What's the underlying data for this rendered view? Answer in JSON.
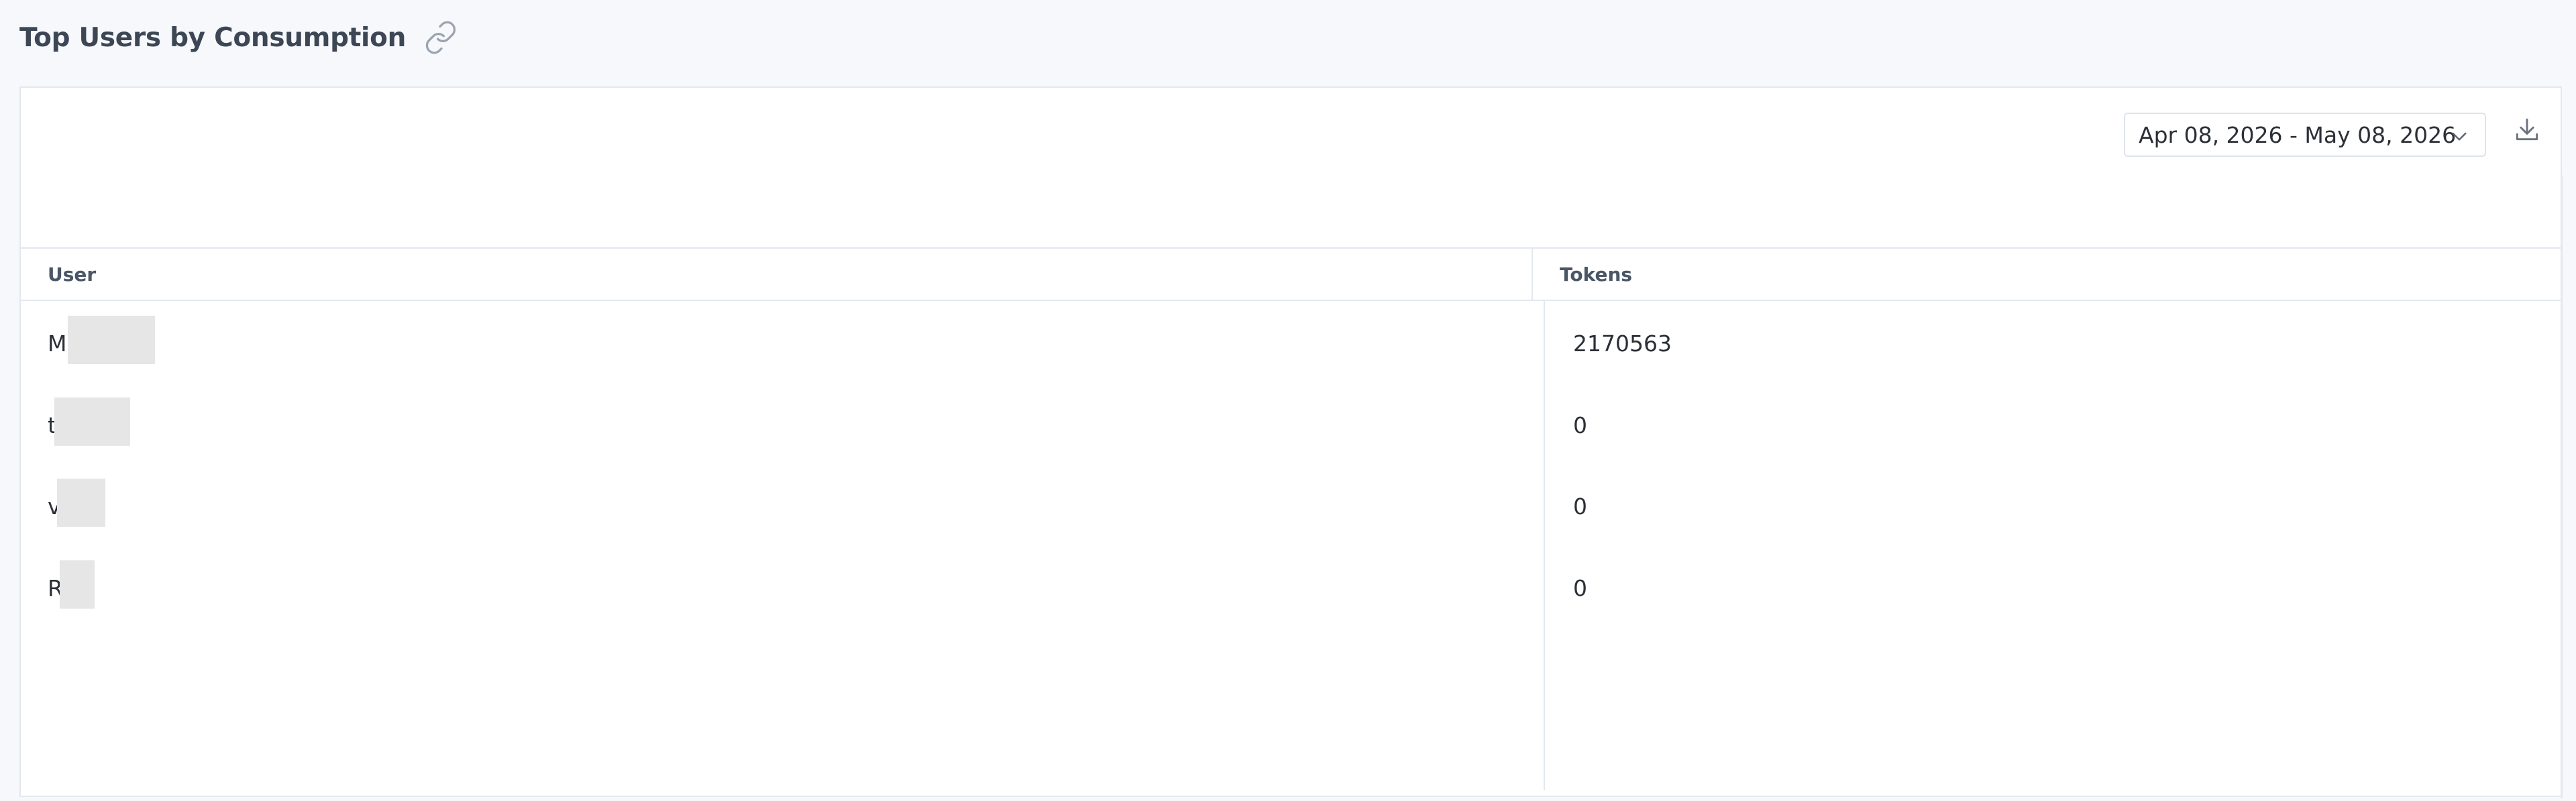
{
  "header": {
    "title": "Top Users by Consumption",
    "link_icon": "link-icon"
  },
  "toolbar": {
    "date_range": "Apr 08, 2026 - May 08, 2026",
    "chevron_icon": "chevron-down-icon",
    "download_icon": "download-icon"
  },
  "table": {
    "columns": [
      "User",
      "Tokens"
    ],
    "rows": [
      {
        "user": "M          d",
        "tokens": "2170563"
      },
      {
        "user": "t        i",
        "tokens": "0"
      },
      {
        "user": "v     a",
        "tokens": "0"
      },
      {
        "user": "R    y",
        "tokens": "0"
      }
    ]
  },
  "colors": {
    "background": "#f6f8fb",
    "panel": "#ffffff",
    "border": "#e3e8ef",
    "title": "#3d4654",
    "redaction": "#e6e6e6"
  }
}
